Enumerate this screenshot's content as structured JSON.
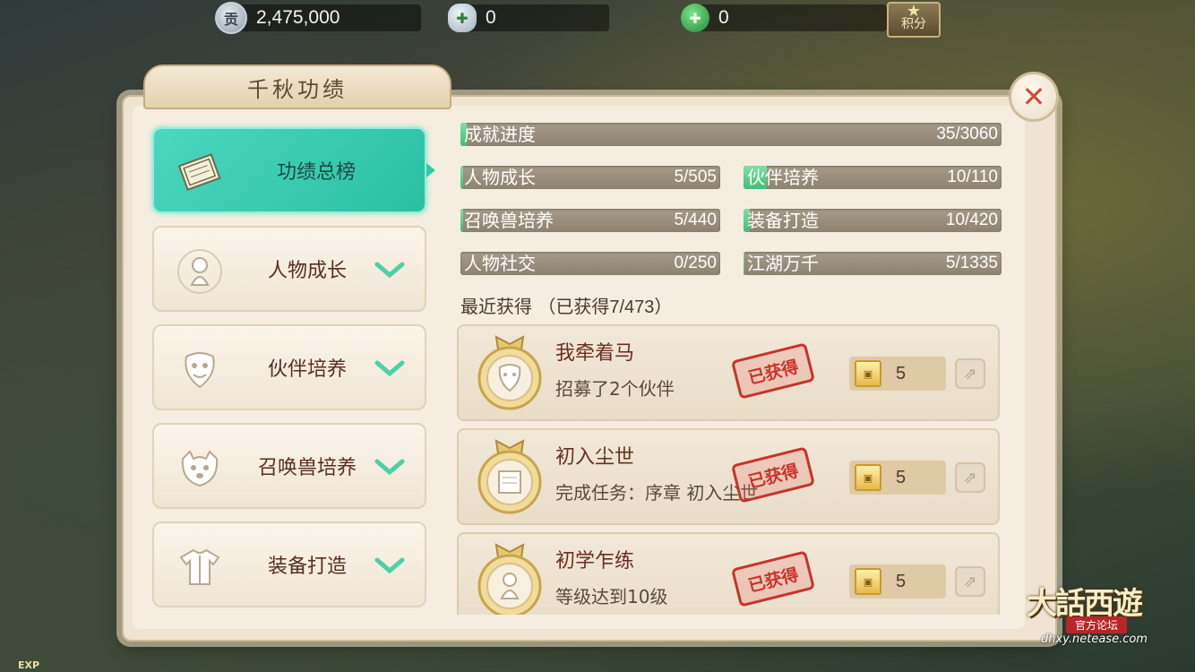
{
  "topbar": {
    "gongxian": {
      "icon": "contribution-coin-icon",
      "glyph": "贡",
      "value": "2,475,000"
    },
    "silver": {
      "icon": "silver-ingot-icon",
      "glyph": "✚",
      "value": "0"
    },
    "jade": {
      "icon": "jade-icon",
      "glyph": "✚",
      "value": "0"
    },
    "score_label": "积分"
  },
  "panel": {
    "title": "千秋功绩",
    "close": "✕"
  },
  "nav": [
    {
      "label": "功绩总榜",
      "icon": "ledger-icon",
      "active": true
    },
    {
      "label": "人物成长",
      "icon": "character-icon",
      "active": false
    },
    {
      "label": "伙伴培养",
      "icon": "partner-mask-icon",
      "active": false
    },
    {
      "label": "召唤兽培养",
      "icon": "summon-beast-icon",
      "active": false
    },
    {
      "label": "装备打造",
      "icon": "armor-icon",
      "active": false
    }
  ],
  "progress": {
    "overall": {
      "label": "成就进度",
      "value": "35/3060",
      "done": 35,
      "total": 3060
    },
    "categories": [
      {
        "label": "人物成长",
        "value": "5/505",
        "done": 5,
        "total": 505
      },
      {
        "label": "伙伴培养",
        "value": "10/110",
        "done": 10,
        "total": 110
      },
      {
        "label": "召唤兽培养",
        "value": "5/440",
        "done": 5,
        "total": 440
      },
      {
        "label": "装备打造",
        "value": "10/420",
        "done": 10,
        "total": 420
      },
      {
        "label": "人物社交",
        "value": "0/250",
        "done": 0,
        "total": 250
      },
      {
        "label": "江湖万千",
        "value": "5/1335",
        "done": 5,
        "total": 1335
      }
    ]
  },
  "recent": {
    "title": "最近获得",
    "count": "（已获得7/473）",
    "items": [
      {
        "title": "我牵着马",
        "desc": "招募了2个伙伴",
        "stamp": "已获得",
        "reward": "5",
        "medal_icon": "partner-mask-icon"
      },
      {
        "title": "初入尘世",
        "desc": "完成任务：序章 初入尘世",
        "stamp": "已获得",
        "reward": "5",
        "medal_icon": "scroll-icon"
      },
      {
        "title": "初学乍练",
        "desc": "等级达到10级",
        "stamp": "已获得",
        "reward": "5",
        "medal_icon": "character-icon"
      }
    ]
  },
  "watermark": {
    "name": "大話西遊",
    "sub": "官方论坛",
    "url": "dhxy.netease.com"
  },
  "exp_label": "EXP"
}
